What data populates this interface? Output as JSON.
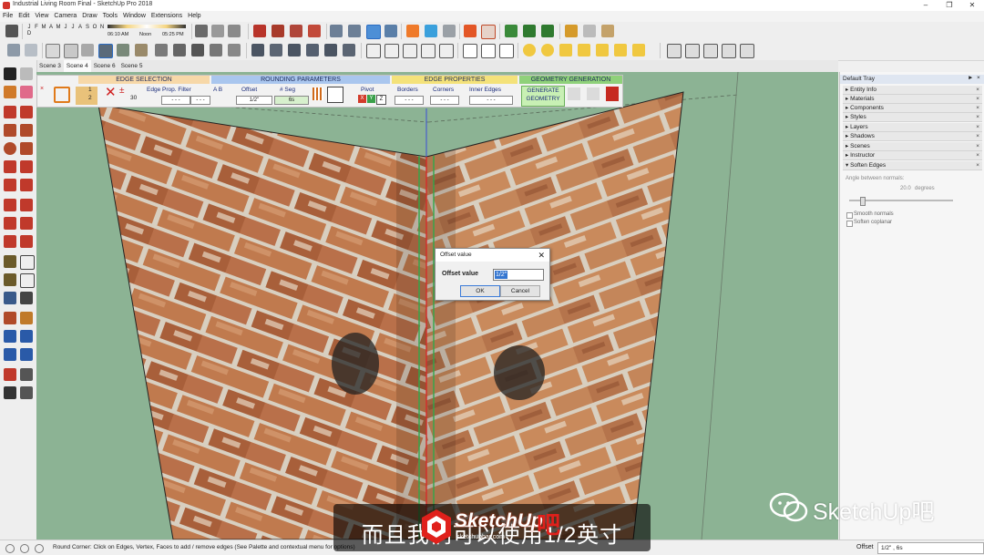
{
  "window": {
    "title": "Industrial Living Room Final - SketchUp Pro 2018"
  },
  "menu": [
    "File",
    "Edit",
    "View",
    "Camera",
    "Draw",
    "Tools",
    "Window",
    "Extensions",
    "Help"
  ],
  "shadow_toolbar": {
    "months": [
      "J",
      "F",
      "M",
      "A",
      "M",
      "J",
      "J",
      "A",
      "S",
      "O",
      "N",
      "D"
    ],
    "time_start": "06:10 AM",
    "noon": "Noon",
    "time_end": "05:25 PM"
  },
  "scenes": [
    "Scene 3",
    "Scene 4",
    "Scene 6",
    "Scene 5"
  ],
  "round_corner": {
    "sections": {
      "edge_selection": "EDGE SELECTION",
      "rounding_parameters": "ROUNDING PARAMETERS",
      "edge_properties": "EDGE PROPERTIES",
      "geometry_generation": "GEOMETRY GENERATION"
    },
    "ratio_top": "1",
    "ratio_bottom": "2",
    "angle_value": "30",
    "edge_prop_filter": "Edge Prop. Filter",
    "ab_label": "A B",
    "offset_label": "Offset",
    "offset_value": "1/2\"",
    "seg_label": "# Seg",
    "seg_value": "6s",
    "pivot_label": "Pivot",
    "axes": [
      "X",
      "Y",
      "Z"
    ],
    "borders_label": "Borders",
    "corners_label": "Corners",
    "inner_edges_label": "Inner Edges",
    "generate_line1": "GENERATE",
    "generate_line2": "GEOMETRY"
  },
  "dialog": {
    "title": "Offset value",
    "label": "Offset value",
    "value": "1/2\"",
    "ok_label": "OK",
    "cancel_label": "Cancel"
  },
  "tray": {
    "title": "Default Tray",
    "panels": [
      "Entity Info",
      "Materials",
      "Components",
      "Styles",
      "Layers",
      "Shadows",
      "Scenes",
      "Instructor",
      "Soften Edges"
    ],
    "soften": {
      "angle_label": "Angle between normals:",
      "angle_value": "20.0",
      "angle_unit": "degrees",
      "smooth_normals": "Smooth normals",
      "soften_coplanar": "Soften coplanar"
    }
  },
  "status": {
    "message": "Round Corner: Click on Edges, Vertex, Faces to add / remove edges (See Palette and contextual menu for options)",
    "vcb_label": "Offset",
    "vcb_value": "1/2\" , 6s"
  },
  "overlay": {
    "subtitle": "而且我们可以使用1/2英寸",
    "logo_text": "SketchUp",
    "logo_url": "sketchupbar.com",
    "logo_char": "吧",
    "watermark": "SketchUp吧"
  },
  "colors": {
    "viewport_bg": "#8cb394",
    "brick_dark": "#7d4a2c",
    "brick_light": "#c98a5c",
    "mortar": "#d8cfc0",
    "accent_red": "#e0201b",
    "selection_blue": "#3476d0"
  }
}
